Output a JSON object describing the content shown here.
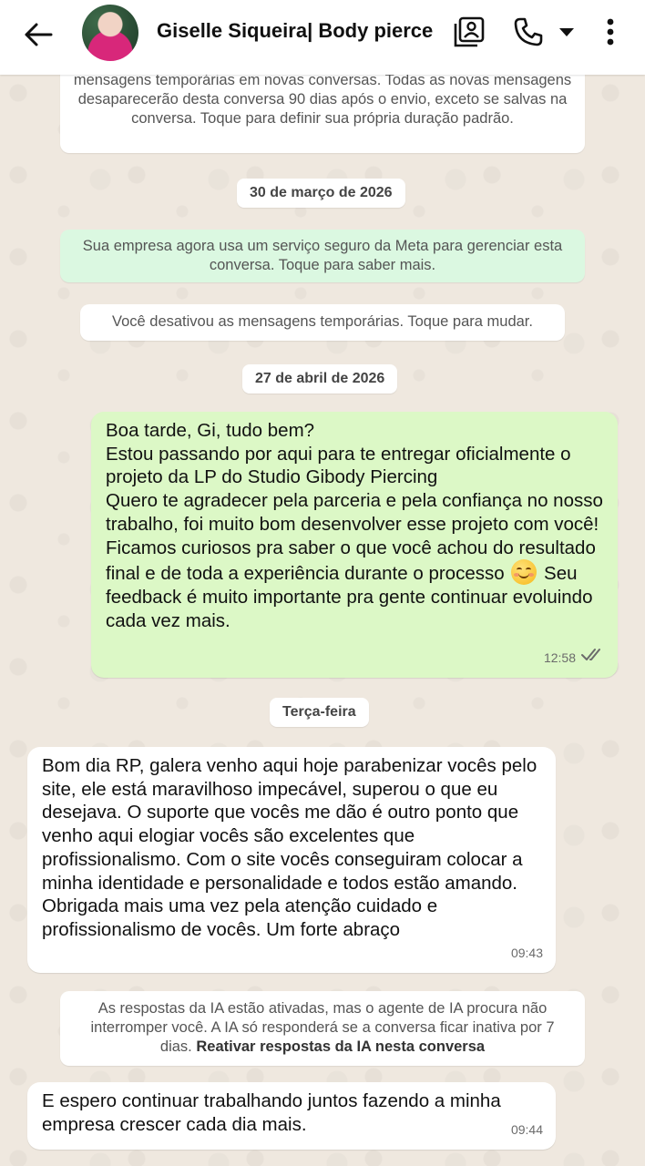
{
  "header": {
    "title": "Giselle Siqueira| Body pierce"
  },
  "messages": {
    "encryption_notice": "mensagens temporárias em novas conversas. Todas as novas mensagens desaparecerão desta conversa 90 dias após o envio, exceto se salvas na conversa. Toque para definir sua própria duração padrão.",
    "date_1": "30 de março de 2026",
    "meta_notice": "Sua empresa agora usa um serviço seguro da Meta para gerenciar esta conversa. Toque para saber mais.",
    "temp_notice": "Você desativou as mensagens temporárias. Toque para mudar.",
    "date_2": "27 de abril de 2026",
    "out_1_part1": "Boa tarde, Gi, tudo bem?\nEstou passando por aqui para te entregar oficialmente o projeto da LP do Studio Gibody Piercing\nQuero te agradecer pela parceria e pela confiança no nosso trabalho, foi muito bom desenvolver esse projeto com você!\nFicamos curiosos pra saber o que você achou do resultado final e de toda a experiência durante o processo",
    "out_1_part2": "Seu feedback é muito importante pra gente continuar evoluindo cada vez mais.",
    "out_1_time": "12:58",
    "date_3": "Terça-feira",
    "in_1": "Bom dia RP, galera venho aqui hoje parabenizar vocês pelo site, ele está maravilhoso impecável, superou o que eu desejava. O suporte que vocês me dão é outro ponto que venho aqui elogiar vocês são excelentes que profissionalismo. Com o site vocês conseguiram colocar a minha identidade e personalidade e todos estão amando. Obrigada mais uma vez pela atenção cuidado e profissionalismo de vocês. Um forte abraço",
    "in_1_time": "09:43",
    "ai_notice": "As respostas da IA estão ativadas, mas o agente de IA procura não interromper você. A IA só responderá se a conversa ficar inativa por 7 dias.",
    "ai_notice_link": "Reativar respostas da IA nesta conversa",
    "in_2": "E espero continuar trabalhando juntos fazendo a minha empresa crescer cada dia mais.",
    "in_2_time": "09:44"
  },
  "colors": {
    "outgoing_bubble": "#dcf8c6",
    "incoming_bubble": "#ffffff",
    "read_ticks": "#6b6b6b"
  }
}
